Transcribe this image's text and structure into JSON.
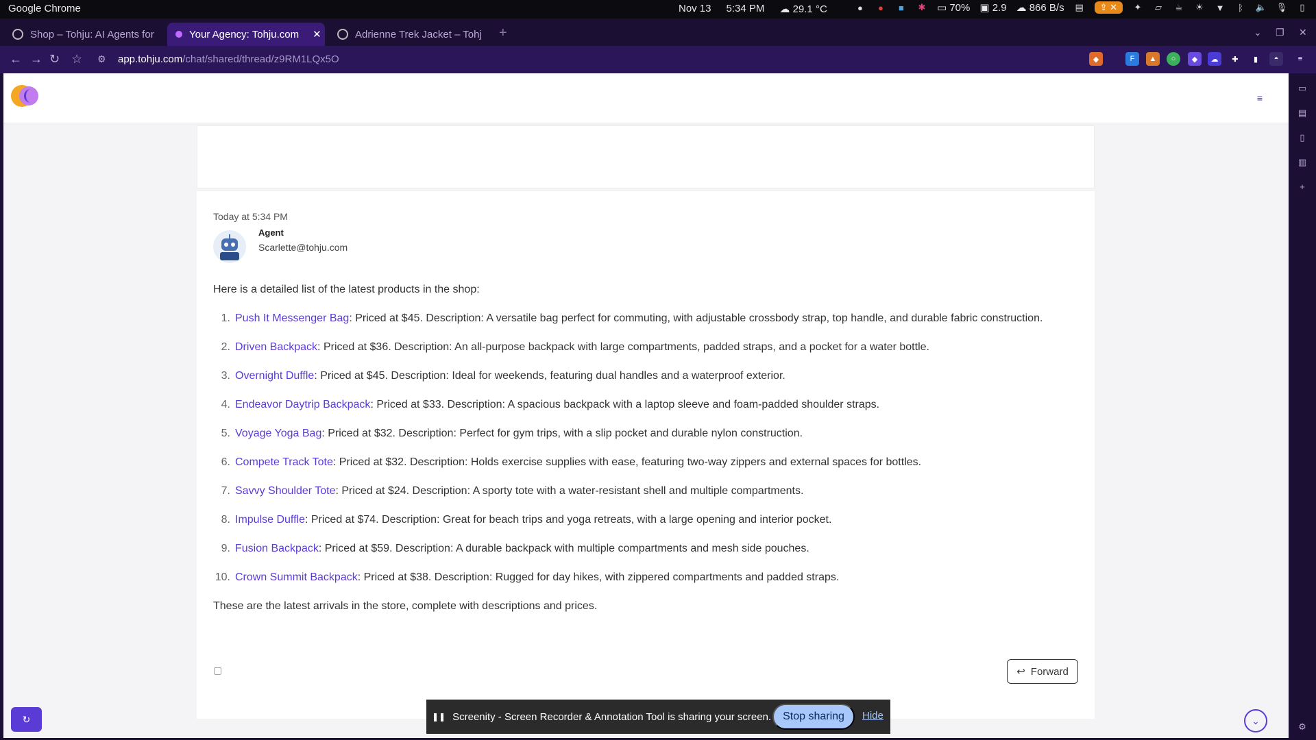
{
  "os": {
    "app_name": "Google Chrome",
    "date": "Nov 13",
    "time": "5:34 PM",
    "weather": "29.1 °C",
    "battery": "70%",
    "load": "2.9",
    "network": "866 B/s"
  },
  "tabs": [
    {
      "label": "Shop – Tohju: AI Agents for",
      "active": false
    },
    {
      "label": "Your Agency: Tohju.com",
      "active": true
    },
    {
      "label": "Adrienne Trek Jacket – Tohj",
      "active": false
    }
  ],
  "address": {
    "domain": "app.tohju.com",
    "path": "/chat/shared/thread/z9RM1LQx5O"
  },
  "chat": {
    "timestamp": "Today at 5:34 PM",
    "agent_name": "Agent",
    "agent_email": "Scarlette@tohju.com",
    "intro": "Here is a detailed list of the latest products in the shop:",
    "items": [
      {
        "num": "1.",
        "name": "Push It Messenger Bag",
        "desc": ": Priced at $45. Description: A versatile bag perfect for commuting, with adjustable crossbody strap, top handle, and durable fabric construction."
      },
      {
        "num": "2.",
        "name": "Driven Backpack",
        "desc": ": Priced at $36. Description: An all-purpose backpack with large compartments, padded straps, and a pocket for a water bottle."
      },
      {
        "num": "3.",
        "name": "Overnight Duffle",
        "desc": ": Priced at $45. Description: Ideal for weekends, featuring dual handles and a waterproof exterior."
      },
      {
        "num": "4.",
        "name": "Endeavor Daytrip Backpack",
        "desc": ": Priced at $33. Description: A spacious backpack with a laptop sleeve and foam-padded shoulder straps."
      },
      {
        "num": "5.",
        "name": "Voyage Yoga Bag",
        "desc": ": Priced at $32. Description: Perfect for gym trips, with a slip pocket and durable nylon construction."
      },
      {
        "num": "6.",
        "name": "Compete Track Tote",
        "desc": ": Priced at $32. Description: Holds exercise supplies with ease, featuring two-way zippers and external spaces for bottles."
      },
      {
        "num": "7.",
        "name": "Savvy Shoulder Tote",
        "desc": ": Priced at $24. Description: A sporty tote with a water-resistant shell and multiple compartments."
      },
      {
        "num": "8.",
        "name": "Impulse Duffle",
        "desc": ": Priced at $74. Description: Great for beach trips and yoga retreats, with a large opening and interior pocket."
      },
      {
        "num": "9.",
        "name": "Fusion Backpack",
        "desc": ": Priced at $59. Description: A durable backpack with multiple compartments and mesh side pouches."
      },
      {
        "num": "10.",
        "name": "Crown Summit Backpack",
        "desc": ": Priced at $38. Description: Rugged for day hikes, with zippered compartments and padded straps."
      }
    ],
    "outro": "These are the latest arrivals in the store, complete with descriptions and prices.",
    "forward_label": "Forward"
  },
  "share_bar": {
    "message": "Screenity - Screen Recorder & Annotation Tool is sharing your screen.",
    "stop_label": "Stop sharing",
    "hide_label": "Hide"
  },
  "colors": {
    "accent": "#5b3bd6",
    "tab_active": "#3a1c78",
    "chrome_bg": "#1b0f33"
  }
}
